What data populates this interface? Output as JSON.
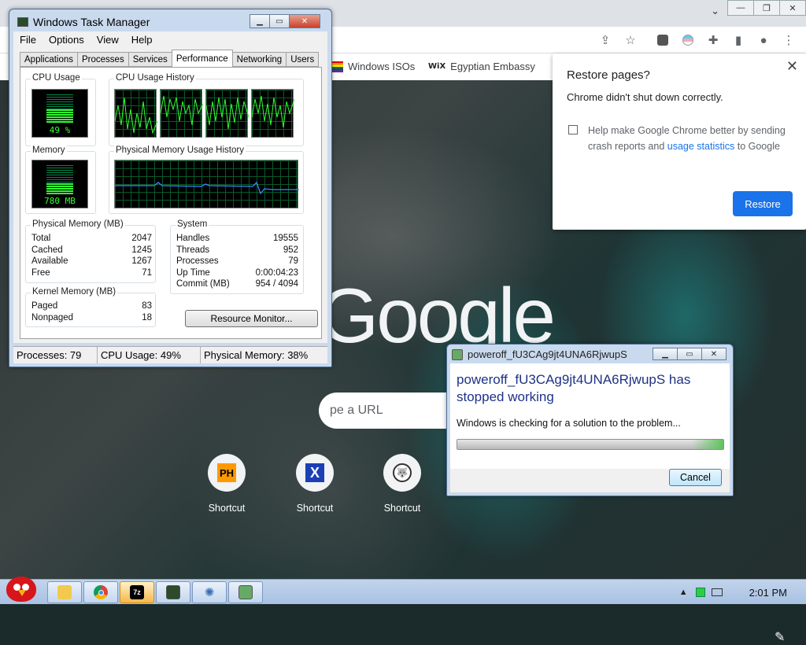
{
  "chrome": {
    "titlebar_chevron": "⌄",
    "window_buttons": [
      "—",
      "❐",
      "✕"
    ],
    "bookmarks": [
      {
        "label": "Windows ISOs"
      },
      {
        "label": "Egyptian Embassy",
        "icon_text": "WiX"
      }
    ],
    "ntp": {
      "logo": "Google",
      "search_placeholder": "pe a URL",
      "shortcuts": [
        {
          "label": "Shortcut",
          "icon_text": "PH"
        },
        {
          "label": "Shortcut",
          "icon_text": "X"
        },
        {
          "label": "Shortcut",
          "icon_text": "🐺"
        }
      ]
    },
    "restore_popup": {
      "title": "Restore pages?",
      "subtitle": "Chrome didn't shut down correctly.",
      "checkbox_text": "Help make Google Chrome better by sending crash reports and",
      "checkbox_link": "usage statistics",
      "checkbox_tail": "to Google",
      "restore_label": "Restore",
      "close_glyph": "✕"
    }
  },
  "task_manager": {
    "title": "Windows Task Manager",
    "menu": [
      "File",
      "Options",
      "View",
      "Help"
    ],
    "tabs": [
      "Applications",
      "Processes",
      "Services",
      "Performance",
      "Networking",
      "Users"
    ],
    "active_tab": "Performance",
    "cpu_usage_label": "CPU Usage",
    "cpu_usage_value": "49 %",
    "cpu_usage_fraction": 0.49,
    "cpu_history_label": "CPU Usage History",
    "memory_label": "Memory",
    "memory_value": "780 MB",
    "memory_fraction": 0.38,
    "mem_history_label": "Physical Memory Usage History",
    "physical_memory": {
      "label": "Physical Memory (MB)",
      "rows": [
        {
          "k": "Total",
          "v": "2047"
        },
        {
          "k": "Cached",
          "v": "1245"
        },
        {
          "k": "Available",
          "v": "1267"
        },
        {
          "k": "Free",
          "v": "71"
        }
      ]
    },
    "kernel_memory": {
      "label": "Kernel Memory (MB)",
      "rows": [
        {
          "k": "Paged",
          "v": "83"
        },
        {
          "k": "Nonpaged",
          "v": "18"
        }
      ]
    },
    "system": {
      "label": "System",
      "rows": [
        {
          "k": "Handles",
          "v": "19555"
        },
        {
          "k": "Threads",
          "v": "952"
        },
        {
          "k": "Processes",
          "v": "79"
        },
        {
          "k": "Up Time",
          "v": "0:00:04:23"
        },
        {
          "k": "Commit (MB)",
          "v": "954 / 4094"
        }
      ]
    },
    "resource_monitor_label": "Resource Monitor...",
    "status": {
      "processes": "Processes: 79",
      "cpu": "CPU Usage: 49%",
      "memory": "Physical Memory: 38%"
    }
  },
  "crash_dialog": {
    "title": "poweroff_fU3CAg9jt4UNA6RjwupS",
    "heading": "poweroff_fU3CAg9jt4UNA6RjwupS has stopped working",
    "message": "Windows is checking for a solution to the problem...",
    "cancel_label": "Cancel"
  },
  "taskbar": {
    "clock": "2:01 PM",
    "buttons": [
      {
        "name": "explorer",
        "icon": "folder-icon"
      },
      {
        "name": "chrome",
        "icon": "chrome-icon"
      },
      {
        "name": "7zip",
        "icon": "7zip-icon",
        "text": "7z"
      },
      {
        "name": "task-manager",
        "icon": "task-manager-icon"
      },
      {
        "name": "network",
        "icon": "network-icon"
      },
      {
        "name": "crash-process",
        "icon": "crash-icon"
      }
    ]
  }
}
